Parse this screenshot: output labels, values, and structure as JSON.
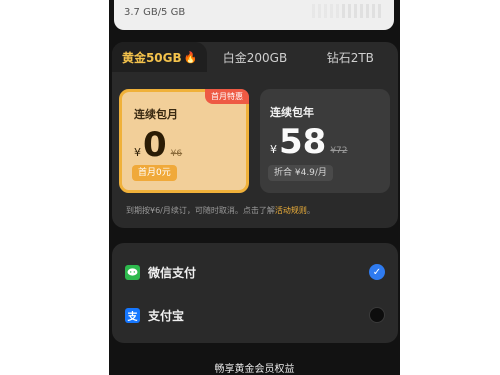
{
  "storage": {
    "usage_text": "3.7 GB/5 GB",
    "used_fraction": 0.74
  },
  "tabs": [
    {
      "label": "黄金50GB",
      "icon": "flame-icon",
      "active": true
    },
    {
      "label": "白金200GB",
      "active": false
    },
    {
      "label": "钻石2TB",
      "active": false
    }
  ],
  "plans": {
    "monthly": {
      "promo_tag": "首月特惠",
      "title": "连续包月",
      "currency": "¥",
      "price": "0",
      "original_price": "¥6",
      "badge": "首月0元",
      "selected": true
    },
    "yearly": {
      "title": "连续包年",
      "currency": "¥",
      "price": "58",
      "original_price": "¥72",
      "badge": "折合 ¥4.9/月",
      "selected": false
    }
  },
  "renew_note": {
    "text": "到期按¥6/月续订，可随时取消。点击了解",
    "link": "活动规则",
    "suffix": "。"
  },
  "payment": {
    "options": [
      {
        "label": "微信支付",
        "icon": "wechat-pay-icon",
        "selected": true
      },
      {
        "label": "支付宝",
        "icon": "alipay-icon",
        "selected": false
      }
    ]
  },
  "footer": {
    "benefits_title": "畅享黄金会员权益"
  },
  "colors": {
    "accent_gold": "#f0b13a",
    "promo_red": "#ee5a44",
    "wechat_green": "#2db94d",
    "alipay_blue": "#1677ff",
    "radio_selected": "#2f7bf0"
  }
}
